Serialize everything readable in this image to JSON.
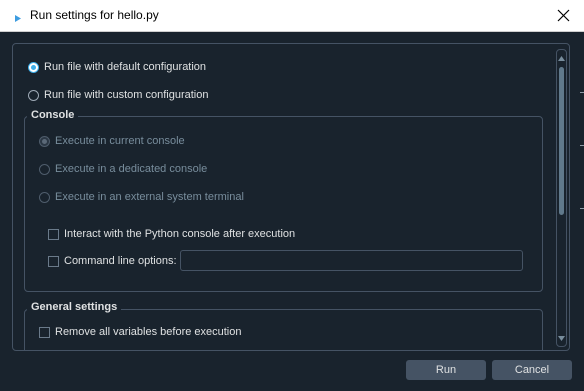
{
  "window": {
    "title": "Run settings for hello.py"
  },
  "run_mode": {
    "default_label": "Run file with default configuration",
    "custom_label": "Run file with custom configuration",
    "selected": "default"
  },
  "console": {
    "title": "Console",
    "options": [
      "Execute in current console",
      "Execute in a dedicated console",
      "Execute in an external system terminal"
    ],
    "interact_label": "Interact with the Python console after execution",
    "cmd_label": "Command line options:",
    "cmd_value": ""
  },
  "general": {
    "title": "General settings",
    "remove_vars_label": "Remove all variables before execution"
  },
  "buttons": {
    "run": "Run",
    "cancel": "Cancel"
  },
  "colors": {
    "background": "#19232d",
    "accent": "#3daee9",
    "border": "#455364"
  },
  "icons": {
    "app": "python-run-icon",
    "close": "close-icon"
  }
}
